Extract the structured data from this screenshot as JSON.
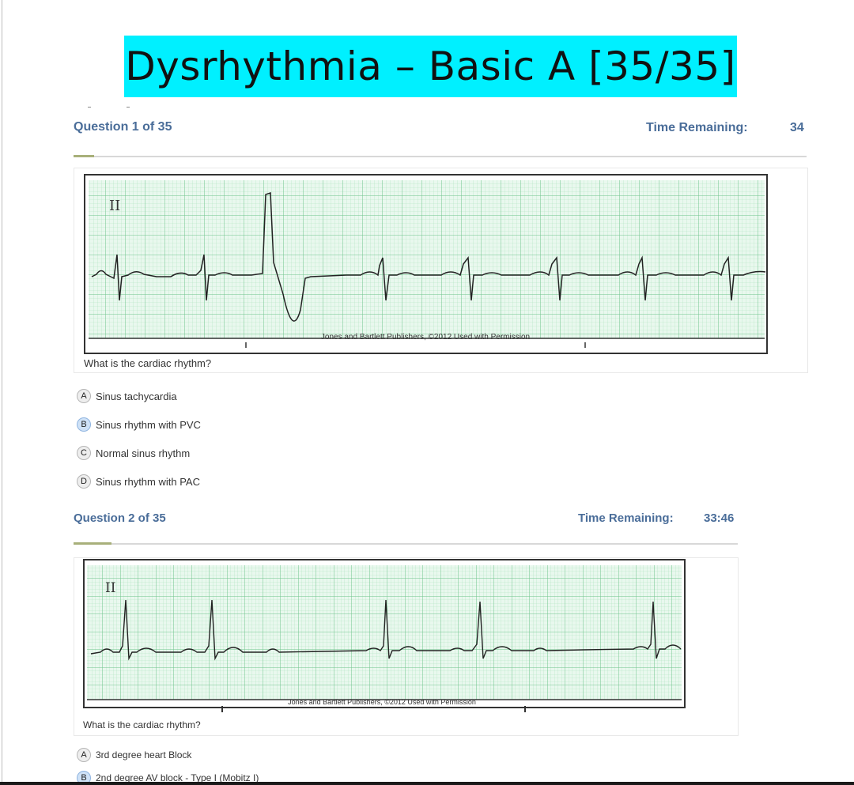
{
  "slide_title": "Dysrhythmia – Basic A [35/35]",
  "colors": {
    "title_bg": "#00f0ff",
    "heading": "#4a6d99",
    "ecg_grid": "#7fcf9a",
    "ecg_bg": "#e4f6ea"
  },
  "questions": [
    {
      "header": "Question 1 of 35",
      "timer_label": "Time Remaining:",
      "timer_value": "34",
      "lead_label": "II",
      "credit": "Jones and Bartlett Publishers, ©2012 Used with Permission",
      "prompt": "What is the cardiac rhythm?",
      "options": [
        {
          "letter": "A",
          "text": "Sinus tachycardia"
        },
        {
          "letter": "B",
          "text": "Sinus rhythm with PVC"
        },
        {
          "letter": "C",
          "text": "Normal sinus rhythm"
        },
        {
          "letter": "D",
          "text": "Sinus rhythm with PAC"
        }
      ]
    },
    {
      "header": "Question 2 of 35",
      "timer_label": "Time Remaining:",
      "timer_value": "33:46",
      "lead_label": "II",
      "credit": "Jones and Bartlett Publishers, ©2012 Used with Permission",
      "prompt": "What is the cardiac rhythm?",
      "options": [
        {
          "letter": "A",
          "text": "3rd degree heart Block"
        },
        {
          "letter": "B",
          "text": "2nd degree AV block - Type I (Mobitz I)"
        }
      ]
    }
  ]
}
